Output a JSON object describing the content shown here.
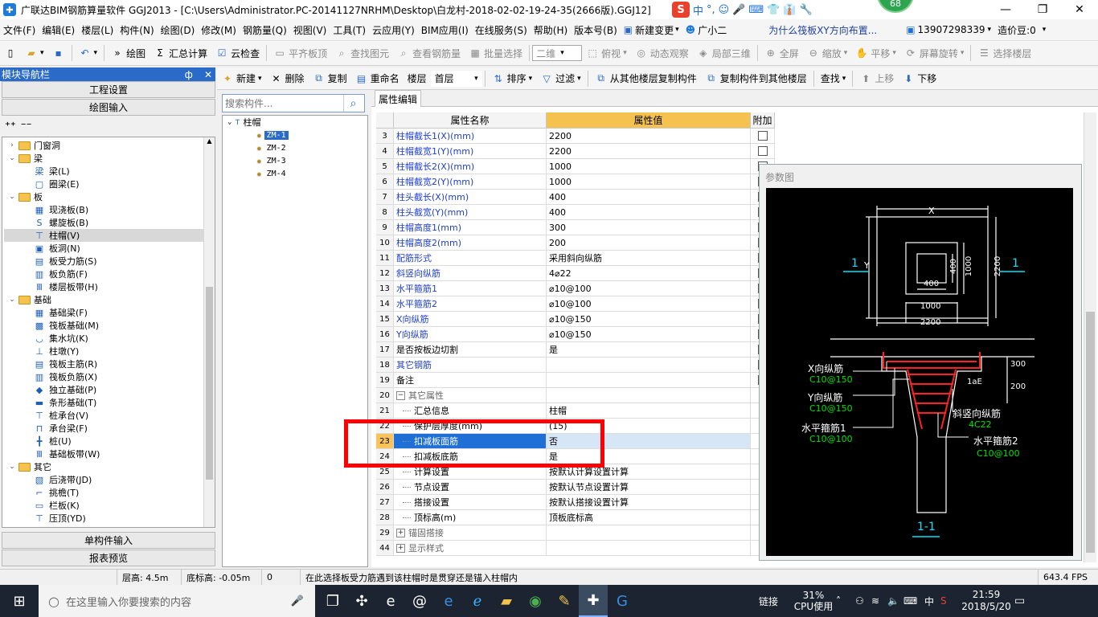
{
  "window": {
    "title": "广联达BIM钢筋算量软件 GGJ2013 - [C:\\Users\\Administrator.PC-20141127NRHM\\Desktop\\白龙村-2018-02-02-19-24-35(2666版).GGJ12]",
    "minimize": "—",
    "restore": "❐",
    "close": "✕",
    "app_icon": "✚"
  },
  "ime": {
    "logo": "S",
    "lang": "中",
    "icons": [
      "°,",
      "☺",
      "🎤",
      "⌨",
      "👕",
      "👔",
      "🔧"
    ]
  },
  "notification_badge": "68",
  "menu": {
    "items": [
      "文件(F)",
      "编辑(E)",
      "楼层(L)",
      "构件(N)",
      "绘图(D)",
      "修改(M)",
      "钢筋量(Q)",
      "视图(V)",
      "工具(T)",
      "云应用(Y)",
      "BIM应用(I)",
      "在线服务(S)",
      "帮助(H)",
      "版本号(B)"
    ],
    "new_change": "新建变更",
    "assistant": "广小二",
    "question_link": "为什么筏板XY方向布置...",
    "phone": "13907298339",
    "cost_beans": "造价豆:0"
  },
  "toolbar1": {
    "draw": "绘图",
    "sum_calc": "汇总计算",
    "cloud_check": "云检查",
    "flush_slab": "平齐板顶",
    "find_element": "查找图元",
    "view_rebar": "查看钢筋量",
    "batch_select": "批量选择",
    "view_mode": "二维",
    "top_view": "俯视",
    "dynamic_view": "动态观察",
    "local_3d": "局部三维",
    "full_screen": "全屏",
    "zoom": "缩放",
    "pan": "平移",
    "rotate": "屏幕旋转",
    "select_floor": "选择楼层"
  },
  "nav": {
    "title": "模块导航栏",
    "pin": "ф",
    "close": "✕",
    "project_settings": "工程设置",
    "drawing_input": "绘图输入",
    "tree": [
      {
        "type": "folder",
        "label": "门窗洞",
        "exp": "›"
      },
      {
        "type": "folder",
        "label": "梁",
        "exp": "⌄"
      },
      {
        "type": "leaf",
        "label": "梁(L)",
        "icon": "梁"
      },
      {
        "type": "leaf",
        "label": "圈梁(E)",
        "icon": "▢"
      },
      {
        "type": "folder",
        "label": "板",
        "exp": "⌄"
      },
      {
        "type": "leaf",
        "label": "现浇板(B)",
        "icon": "▦"
      },
      {
        "type": "leaf",
        "label": "螺旋板(B)",
        "icon": "S"
      },
      {
        "type": "leaf",
        "label": "柱帽(V)",
        "icon": "⊤",
        "selected": true
      },
      {
        "type": "leaf",
        "label": "板洞(N)",
        "icon": "▣"
      },
      {
        "type": "leaf",
        "label": "板受力筋(S)",
        "icon": "▤"
      },
      {
        "type": "leaf",
        "label": "板负筋(F)",
        "icon": "▥"
      },
      {
        "type": "leaf",
        "label": "楼层板带(H)",
        "icon": "Ⅲ"
      },
      {
        "type": "folder",
        "label": "基础",
        "exp": "⌄"
      },
      {
        "type": "leaf",
        "label": "基础梁(F)",
        "icon": "▦"
      },
      {
        "type": "leaf",
        "label": "筏板基础(M)",
        "icon": "▩"
      },
      {
        "type": "leaf",
        "label": "集水坑(K)",
        "icon": "◡"
      },
      {
        "type": "leaf",
        "label": "柱墩(Y)",
        "icon": "⊥"
      },
      {
        "type": "leaf",
        "label": "筏板主筋(R)",
        "icon": "▤"
      },
      {
        "type": "leaf",
        "label": "筏板负筋(X)",
        "icon": "▥"
      },
      {
        "type": "leaf",
        "label": "独立基础(P)",
        "icon": "◆"
      },
      {
        "type": "leaf",
        "label": "条形基础(T)",
        "icon": "▬"
      },
      {
        "type": "leaf",
        "label": "桩承台(V)",
        "icon": "⊤"
      },
      {
        "type": "leaf",
        "label": "承台梁(F)",
        "icon": "⊓"
      },
      {
        "type": "leaf",
        "label": "桩(U)",
        "icon": "╋"
      },
      {
        "type": "leaf",
        "label": "基础板带(W)",
        "icon": "Ⅲ"
      },
      {
        "type": "folder",
        "label": "其它",
        "exp": "⌄"
      },
      {
        "type": "leaf",
        "label": "后浇带(JD)",
        "icon": "▧"
      },
      {
        "type": "leaf",
        "label": "挑檐(T)",
        "icon": "⌐"
      },
      {
        "type": "leaf",
        "label": "栏板(K)",
        "icon": "▭"
      },
      {
        "type": "leaf",
        "label": "压顶(YD)",
        "icon": "⊤"
      }
    ],
    "single_input": "单构件输入",
    "report_preview": "报表预览"
  },
  "comp_toolbar": {
    "new": "新建",
    "delete": "删除",
    "copy": "复制",
    "rename": "重命名",
    "floor_label": "楼层",
    "floor_value": "首层",
    "sort": "排序",
    "filter": "过滤",
    "copy_from_other": "从其他楼层复制构件",
    "copy_to_other": "复制构件到其他楼层",
    "find": "查找",
    "move_up": "上移",
    "move_down": "下移"
  },
  "comp_list": {
    "search_placeholder": "搜索构件...",
    "root": "柱帽",
    "items": [
      "ZM-1",
      "ZM-2",
      "ZM-3",
      "ZM-4"
    ]
  },
  "props": {
    "tab": "属性编辑",
    "headers": {
      "name": "属性名称",
      "value": "属性值",
      "extra": "附加"
    },
    "rows": [
      {
        "num": "3",
        "name": "柱帽截长1(X)(mm)",
        "value": "2200",
        "style": "blue",
        "check": true
      },
      {
        "num": "4",
        "name": "柱帽截宽1(Y)(mm)",
        "value": "2200",
        "style": "blue",
        "check": true
      },
      {
        "num": "5",
        "name": "柱帽截长2(X)(mm)",
        "value": "1000",
        "style": "blue",
        "check": true
      },
      {
        "num": "6",
        "name": "柱帽截宽2(Y)(mm)",
        "value": "1000",
        "style": "blue",
        "check": true
      },
      {
        "num": "7",
        "name": "柱头截长(X)(mm)",
        "value": "400",
        "style": "blue",
        "check": true
      },
      {
        "num": "8",
        "name": "柱头截宽(Y)(mm)",
        "value": "400",
        "style": "blue",
        "check": true
      },
      {
        "num": "9",
        "name": "柱帽高度1(mm)",
        "value": "300",
        "style": "blue",
        "check": true
      },
      {
        "num": "10",
        "name": "柱帽高度2(mm)",
        "value": "200",
        "style": "blue",
        "check": true
      },
      {
        "num": "11",
        "name": "配筋形式",
        "value": "采用斜向纵筋",
        "style": "blue",
        "check": true
      },
      {
        "num": "12",
        "name": "斜竖向纵筋",
        "value": "4⌀22",
        "style": "blue",
        "check": true
      },
      {
        "num": "13",
        "name": "水平箍筋1",
        "value": "⌀10@100",
        "style": "blue",
        "check": true
      },
      {
        "num": "14",
        "name": "水平箍筋2",
        "value": "⌀10@100",
        "style": "blue",
        "check": true
      },
      {
        "num": "15",
        "name": "X向纵筋",
        "value": "⌀10@150",
        "style": "blue",
        "check": true
      },
      {
        "num": "16",
        "name": "Y向纵筋",
        "value": "⌀10@150",
        "style": "blue",
        "check": true
      },
      {
        "num": "17",
        "name": "是否按板边切割",
        "value": "是",
        "style": "black",
        "check": true
      },
      {
        "num": "18",
        "name": "其它钢筋",
        "value": "",
        "style": "blue",
        "check": true
      },
      {
        "num": "19",
        "name": "备注",
        "value": "",
        "style": "black",
        "check": true
      },
      {
        "num": "20",
        "name": "其它属性",
        "value": "",
        "style": "grey",
        "group": "−"
      },
      {
        "num": "21",
        "name": "汇总信息",
        "value": "柱帽",
        "style": "black",
        "indent": true
      },
      {
        "num": "22",
        "name": "保护层厚度(mm)",
        "value": "(15)",
        "style": "black",
        "indent": true
      },
      {
        "num": "23",
        "name": "扣减板面筋",
        "value": "否",
        "style": "black",
        "indent": true,
        "selected": true
      },
      {
        "num": "24",
        "name": "扣减板底筋",
        "value": "是",
        "style": "black",
        "indent": true
      },
      {
        "num": "25",
        "name": "计算设置",
        "value": "按默认计算设置计算",
        "style": "black",
        "indent": true
      },
      {
        "num": "26",
        "name": "节点设置",
        "value": "按默认节点设置计算",
        "style": "black",
        "indent": true
      },
      {
        "num": "27",
        "name": "搭接设置",
        "value": "按默认搭接设置计算",
        "style": "black",
        "indent": true
      },
      {
        "num": "28",
        "name": "顶标高(m)",
        "value": "顶板底标高",
        "style": "black",
        "indent": true
      },
      {
        "num": "29",
        "name": "锚固搭接",
        "value": "",
        "style": "grey",
        "group": "+"
      },
      {
        "num": "44",
        "name": "显示样式",
        "value": "",
        "style": "grey",
        "group": "+"
      }
    ]
  },
  "param_diagram": {
    "title": "参数图",
    "labels": {
      "x": "X",
      "y": "Y",
      "sec1": "1",
      "d400v": "400",
      "d1000v": "1000",
      "d2200v": "2200",
      "d400h": "400",
      "d1000h": "1000",
      "d2200h": "2200",
      "h300": "300",
      "h200": "200",
      "la": "1aE",
      "x_rebar": "X向纵筋",
      "x_rebar_val": "C10@150",
      "y_rebar": "Y向纵筋",
      "y_rebar_val": "C10@150",
      "hstir1": "水平箍筋1",
      "hstir1_val": "C10@100",
      "diag_rebar": "斜竖向纵筋",
      "diag_rebar_val": "4C22",
      "hstir2": "水平箍筋2",
      "hstir2_val": "C10@100",
      "section": "1-1"
    }
  },
  "status": {
    "floor_height": "层高: 4.5m",
    "bottom_elev": "底标高: -0.05m",
    "count": "0",
    "hint": "在此选择板受力筋遇到该柱帽时是贯穿还是锚入柱帽内",
    "fps": "643.4 FPS"
  },
  "taskbar": {
    "search_placeholder": "在这里输入你要搜索的内容",
    "link": "链接",
    "cpu_percent": "31%",
    "cpu_label": "CPU使用",
    "ime": "中",
    "time": "21:59",
    "date": "2018/5/20"
  },
  "colors": {
    "nav_title_bg": "#2a6bc9",
    "highlight": "#ff0000",
    "selected_name_bg": "#1f6fd6",
    "diagram_bg": "#000000",
    "diagram_white": "#ffffff",
    "diagram_cyan": "#00e5ff",
    "diagram_green": "#00e000",
    "diagram_red": "#ff2020"
  }
}
